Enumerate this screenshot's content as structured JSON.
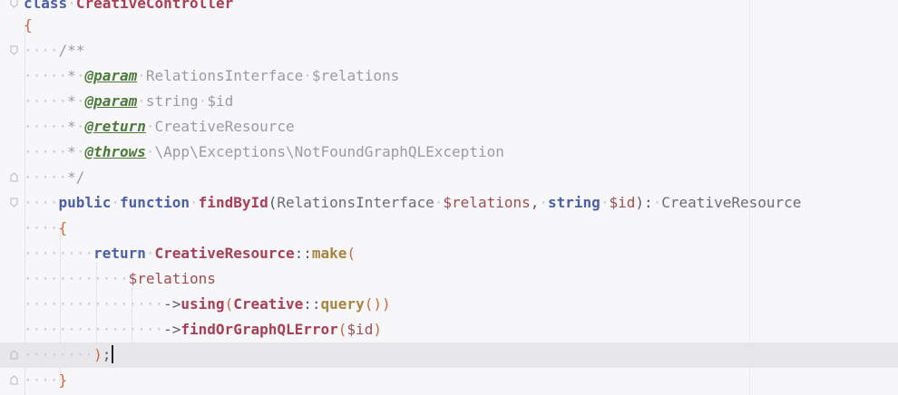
{
  "editor": {
    "lines": [
      {
        "indent": "",
        "parts": [
          [
            "kw",
            "class"
          ],
          [
            "ws",
            "·"
          ],
          [
            "cls",
            "CreativeController"
          ]
        ]
      },
      {
        "indent": "",
        "parts": [
          [
            "brace",
            "{"
          ]
        ]
      },
      {
        "indent": "····",
        "parts": [
          [
            "doc",
            "/**"
          ]
        ]
      },
      {
        "indent": "·····",
        "parts": [
          [
            "doc",
            "*"
          ],
          [
            "ws",
            "·"
          ],
          [
            "tag",
            "@param"
          ],
          [
            "ws",
            "·"
          ],
          [
            "doc",
            "RelationsInterface"
          ],
          [
            "ws",
            "·"
          ],
          [
            "doc",
            "$relations"
          ]
        ]
      },
      {
        "indent": "·····",
        "parts": [
          [
            "doc",
            "*"
          ],
          [
            "ws",
            "·"
          ],
          [
            "tag",
            "@param"
          ],
          [
            "ws",
            "·"
          ],
          [
            "doc",
            "string"
          ],
          [
            "ws",
            "·"
          ],
          [
            "doc",
            "$id"
          ]
        ]
      },
      {
        "indent": "·····",
        "parts": [
          [
            "doc",
            "*"
          ],
          [
            "ws",
            "·"
          ],
          [
            "tag",
            "@return"
          ],
          [
            "ws",
            "·"
          ],
          [
            "doc",
            "CreativeResource"
          ]
        ]
      },
      {
        "indent": "·····",
        "parts": [
          [
            "doc",
            "*"
          ],
          [
            "ws",
            "·"
          ],
          [
            "tag",
            "@throws"
          ],
          [
            "ws",
            "·"
          ],
          [
            "doc",
            "\\App\\Exceptions\\NotFoundGraphQLException"
          ]
        ]
      },
      {
        "indent": "·····",
        "parts": [
          [
            "doc",
            "*/"
          ]
        ]
      },
      {
        "indent": "····",
        "parts": [
          [
            "kw",
            "public"
          ],
          [
            "ws",
            "·"
          ],
          [
            "kw",
            "function"
          ],
          [
            "ws",
            "·"
          ],
          [
            "fn",
            "findById"
          ],
          [
            "punct",
            "("
          ],
          [
            "type",
            "RelationsInterface"
          ],
          [
            "ws",
            "·"
          ],
          [
            "var",
            "$relations"
          ],
          [
            "punct",
            ","
          ],
          [
            "ws",
            "·"
          ],
          [
            "kw",
            "string"
          ],
          [
            "ws",
            "·"
          ],
          [
            "var",
            "$id"
          ],
          [
            "punct",
            "):"
          ],
          [
            "ws",
            "·"
          ],
          [
            "type",
            "CreativeResource"
          ]
        ]
      },
      {
        "indent": "····",
        "parts": [
          [
            "brace",
            "{"
          ]
        ]
      },
      {
        "indent": "········",
        "parts": [
          [
            "kw",
            "return"
          ],
          [
            "ws",
            "·"
          ],
          [
            "cls",
            "CreativeResource"
          ],
          [
            "punct",
            "::"
          ],
          [
            "static",
            "make"
          ],
          [
            "brace",
            "("
          ]
        ]
      },
      {
        "indent": "············",
        "parts": [
          [
            "var",
            "$relations"
          ]
        ]
      },
      {
        "indent": "················",
        "parts": [
          [
            "punct",
            "->"
          ],
          [
            "fn",
            "using"
          ],
          [
            "brace",
            "("
          ],
          [
            "cls",
            "Creative"
          ],
          [
            "punct",
            "::"
          ],
          [
            "static",
            "query"
          ],
          [
            "brace",
            "())"
          ]
        ]
      },
      {
        "indent": "················",
        "parts": [
          [
            "punct",
            "->"
          ],
          [
            "fn",
            "findOrGraphQLError"
          ],
          [
            "brace",
            "("
          ],
          [
            "var",
            "$id"
          ],
          [
            "brace",
            ")"
          ]
        ]
      },
      {
        "indent": "········",
        "parts": [
          [
            "brace",
            ")"
          ],
          [
            "punct",
            ";"
          ]
        ],
        "current": true,
        "caret": true
      },
      {
        "indent": "····",
        "parts": [
          [
            "brace",
            "}"
          ]
        ]
      }
    ]
  }
}
